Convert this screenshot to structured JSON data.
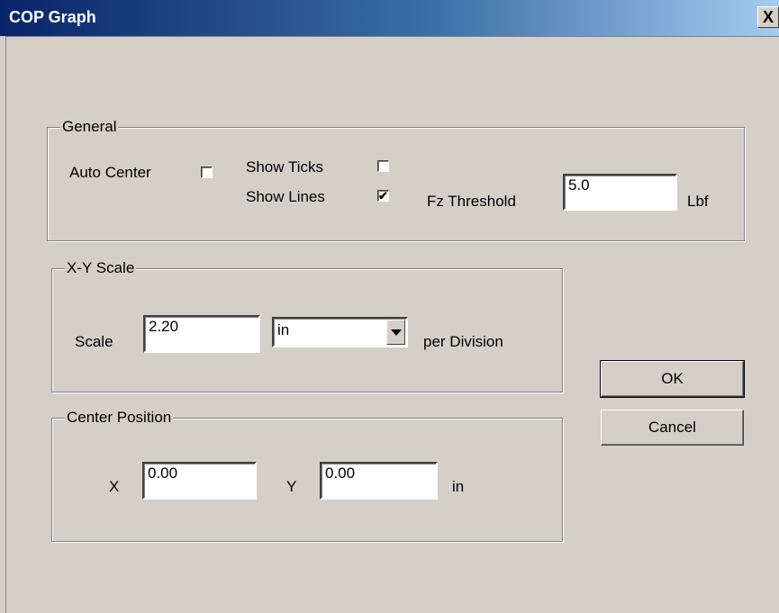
{
  "window": {
    "title": "COP Graph",
    "close_label": "X"
  },
  "general": {
    "label": "General",
    "auto_center": {
      "label": "Auto Center",
      "checked": false
    },
    "show_ticks": {
      "label": "Show Ticks",
      "checked": false
    },
    "show_lines": {
      "label": "Show Lines",
      "checked": true
    },
    "fz_threshold": {
      "label": "Fz Threshold",
      "value": "5.0",
      "unit": "Lbf"
    }
  },
  "xy_scale": {
    "label": "X-Y Scale",
    "scale_label": "Scale",
    "scale_value": "2.20",
    "unit_selected": "in",
    "per_division": "per Division"
  },
  "center_position": {
    "label": "Center Position",
    "x_label": "X",
    "x_value": "0.00",
    "y_label": "Y",
    "y_value": "0.00",
    "unit": "in"
  },
  "buttons": {
    "ok": "OK",
    "cancel": "Cancel"
  },
  "check_glyph": "✔"
}
